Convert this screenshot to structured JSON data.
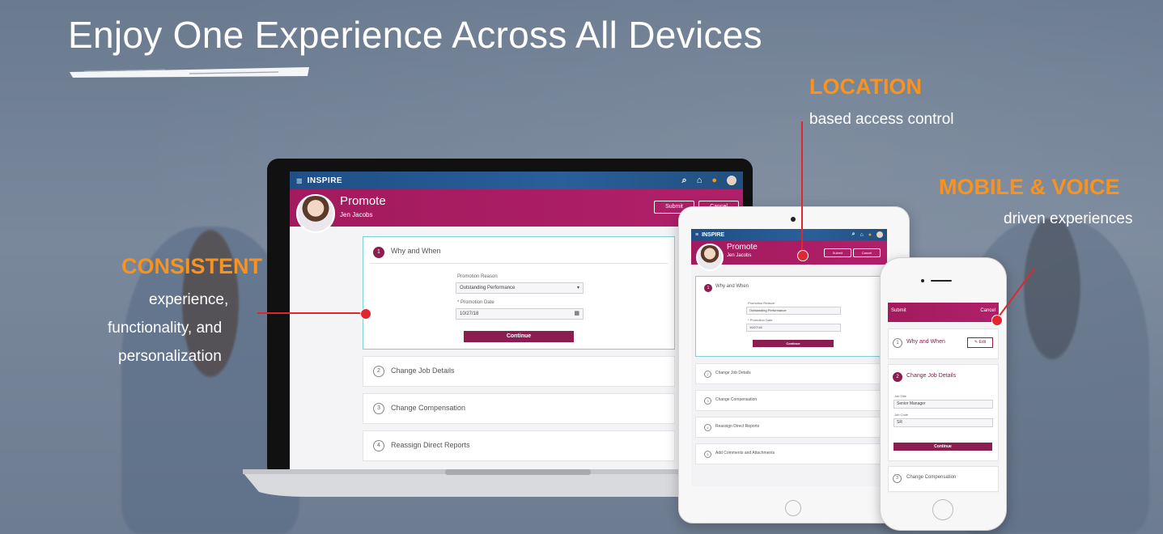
{
  "headline": "Enjoy One Experience Across All Devices",
  "callouts": {
    "location": {
      "title": "LOCATION",
      "text": "based access control"
    },
    "mobile": {
      "title": "MOBILE & VOICE",
      "text": "driven experiences"
    },
    "consistent": {
      "title": "CONSISTENT",
      "line1": "experience,",
      "line2": "functionality, and",
      "line3": "personalization"
    }
  },
  "app": {
    "brand": "INSPIRE",
    "page_title": "Promote",
    "employee": "Jen Jacobs",
    "submit_label": "Submit",
    "cancel_label": "Cancel",
    "steps": [
      {
        "num": "1",
        "label": "Why and When"
      },
      {
        "num": "2",
        "label": "Change Job Details"
      },
      {
        "num": "3",
        "label": "Change Compensation"
      },
      {
        "num": "4",
        "label": "Reassign Direct Reports"
      },
      {
        "num": "5",
        "label": "Add Comments and Attachments"
      }
    ],
    "promotion_reason_label": "Promotion Reason",
    "promotion_reason_value": "Outstanding Performance",
    "promotion_date_label": "* Promotion Date",
    "promotion_date_value": "10/27/18",
    "continue_label": "Continue",
    "phone": {
      "edit_label": "Edit",
      "job_title_label": "Job Title",
      "job_title_value": "Senior Manager",
      "job_code_label": "Job Code",
      "job_code_value": "SR"
    }
  },
  "colors": {
    "accent": "#f7931e",
    "brand": "#a31a5e",
    "marker": "#e0262f",
    "nav": "#1f4f86"
  }
}
